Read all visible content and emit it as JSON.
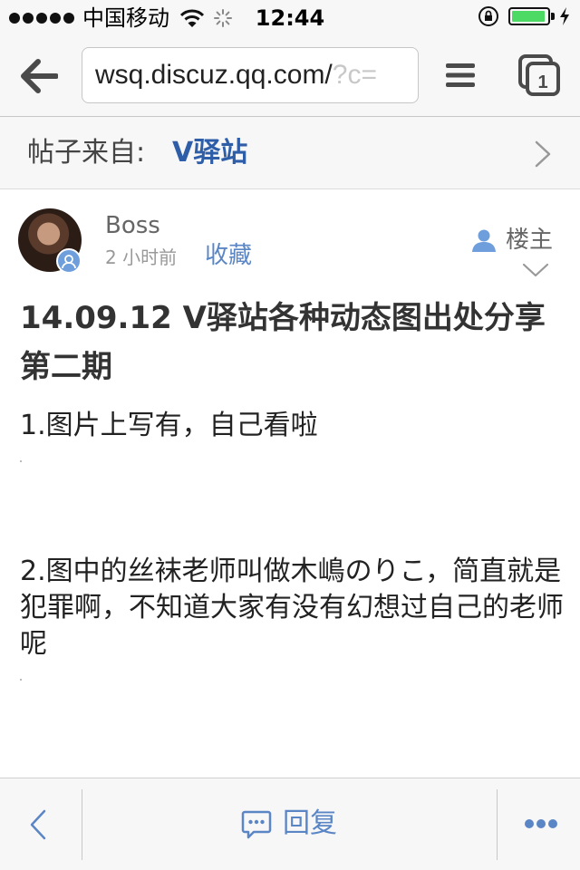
{
  "status_bar": {
    "carrier": "中国移动",
    "time": "12:44",
    "battery_level": 0.95,
    "icons": [
      "signal-icon",
      "wifi-icon",
      "activity-spinner-icon",
      "orientation-lock-icon",
      "battery-icon",
      "charging-bolt-icon"
    ]
  },
  "browser": {
    "url_visible": "wsq.discuz.qq.com/",
    "url_faded": "?c=",
    "icons": [
      "back-arrow-icon",
      "menu-icon",
      "tabs-icon"
    ],
    "tab_count": "1"
  },
  "source": {
    "label": "帖子来自:",
    "name": "V驿站"
  },
  "post": {
    "author": "Boss",
    "time": "2 小时前",
    "favorite": "收藏",
    "op_label": "楼主",
    "title": "14.09.12 V驿站各种动态图出处分享第二期",
    "paragraphs": [
      "1.图片上写有，自己看啦",
      "2.图中的丝袜老师叫做木嶋のりこ，简直就是犯罪啊，不知道大家有没有幻想过自己的老师呢"
    ]
  },
  "bottom_bar": {
    "reply_label": "回复",
    "icons": [
      "back-chevron-icon",
      "comment-icon",
      "more-icon"
    ]
  },
  "colors": {
    "accent": "#5b86c5",
    "source_name": "#2f5ea8",
    "bar_background": "#f7f7f7",
    "battery_green": "#4cd964"
  }
}
